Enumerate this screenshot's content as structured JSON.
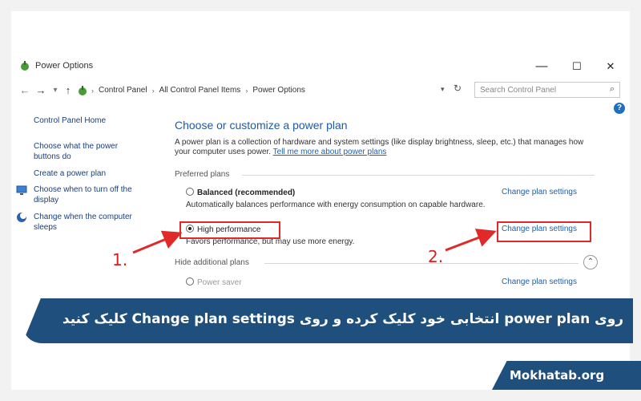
{
  "window": {
    "title": "Power Options",
    "minimize": "—",
    "maximize": "☐",
    "close": "✕"
  },
  "address_bar": {
    "back": "←",
    "forward": "→",
    "recent": "▾",
    "up": "↑",
    "crumbs": [
      "Control Panel",
      "All Control Panel Items",
      "Power Options"
    ],
    "dropdown": "▾",
    "refresh": "↻",
    "search_placeholder": "Search Control Panel"
  },
  "help": "?",
  "sidebar": {
    "items": [
      {
        "label": "Control Panel Home"
      },
      {
        "label": "Choose what the power buttons do"
      },
      {
        "label": "Create a power plan"
      },
      {
        "label": "Choose when to turn off the display"
      },
      {
        "label": "Change when the computer sleeps"
      }
    ]
  },
  "main": {
    "heading": "Choose or customize a power plan",
    "description": "A power plan is a collection of hardware and system settings (like display brightness, sleep, etc.) that manages how your computer uses power.",
    "description_link": "Tell me more about power plans",
    "preferred_label": "Preferred plans",
    "plans": [
      {
        "name": "Balanced (recommended)",
        "desc": "Automatically balances performance with energy consumption on capable hardware.",
        "link": "Change plan settings",
        "selected": false
      },
      {
        "name": "High performance",
        "desc": "Favors performance, but may use more energy.",
        "link": "Change plan settings",
        "selected": true
      }
    ],
    "hide_label": "Hide additional plans",
    "partial_plan": "Power saver",
    "partial_link": "Change plan settings"
  },
  "annotations": {
    "step1": "1.",
    "step2": "2.",
    "color": "#e02a2a"
  },
  "banner": {
    "text": "روی  power plan  انتخابی خود کلیک کرده و روی Change plan settings کلیک کنید",
    "color": "#1f4f7d"
  },
  "site": "Mokhatab.org"
}
